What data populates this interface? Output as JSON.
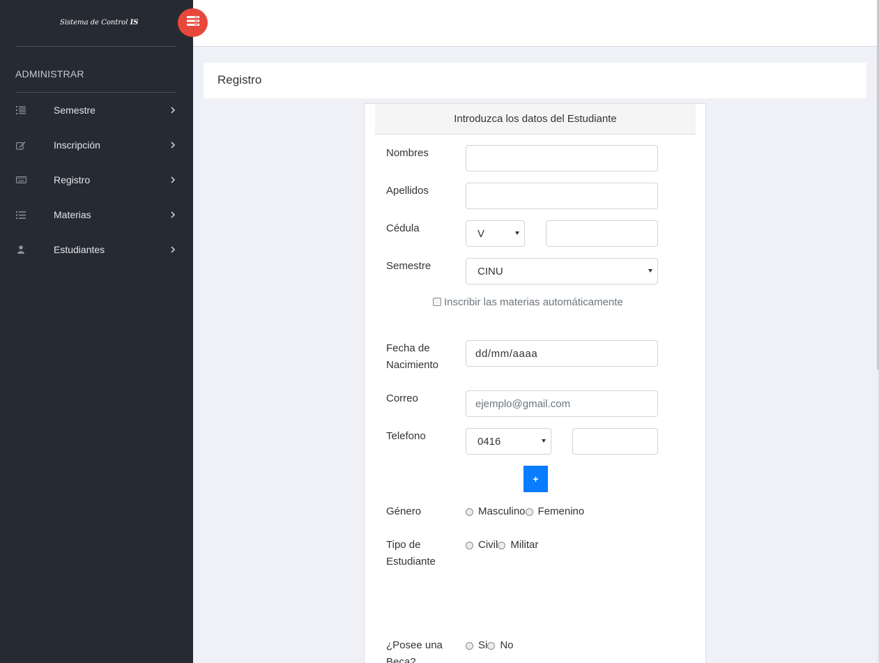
{
  "brand": {
    "text": "Sistema de Control",
    "suffix": "IS"
  },
  "sidebar": {
    "section_title": "ADMINISTRAR",
    "items": [
      {
        "label": "Semestre",
        "icon": "list-ol-icon"
      },
      {
        "label": "Inscripción",
        "icon": "edit-icon"
      },
      {
        "label": "Registro",
        "icon": "keyboard-icon"
      },
      {
        "label": "Materias",
        "icon": "list-icon"
      },
      {
        "label": "Estudiantes",
        "icon": "user-icon"
      }
    ]
  },
  "toggle": {
    "icon": "menu-toggle-icon",
    "color": "#e8483b"
  },
  "page": {
    "title": "Registro"
  },
  "form": {
    "header": "Introduzca los datos del Estudiante",
    "nombres_label": "Nombres",
    "nombres_value": "",
    "apellidos_label": "Apellidos",
    "apellidos_value": "",
    "cedula_label": "Cédula",
    "cedula_type": "V",
    "cedula_number": "",
    "semestre_label": "Semestre",
    "semestre_value": "CINU",
    "auto_inscribir_label": "Inscribir las materias automáticamente",
    "fecha_label_1": "Fecha de",
    "fecha_label_2": "Nacimiento",
    "fecha_placeholder": "dd/mm/aaaa",
    "correo_label": "Correo",
    "correo_placeholder": "ejemplo@gmail.com",
    "telefono_label": "Telefono",
    "telefono_prefix": "0416",
    "telefono_number": "",
    "add_label": "+",
    "genero_label": "Género",
    "genero_options": [
      "Masculino",
      "Femenino"
    ],
    "tipo_label_1": "Tipo de",
    "tipo_label_2": "Estudiante",
    "tipo_options": [
      "Civil",
      "Militar"
    ],
    "beca_label_1": "¿Posee una",
    "beca_label_2": "Beca?",
    "beca_options": [
      "Si",
      "No"
    ]
  },
  "colors": {
    "sidebar_bg": "#262a32",
    "accent_button": "#0a7cff",
    "page_bg": "#f0f1f7"
  }
}
